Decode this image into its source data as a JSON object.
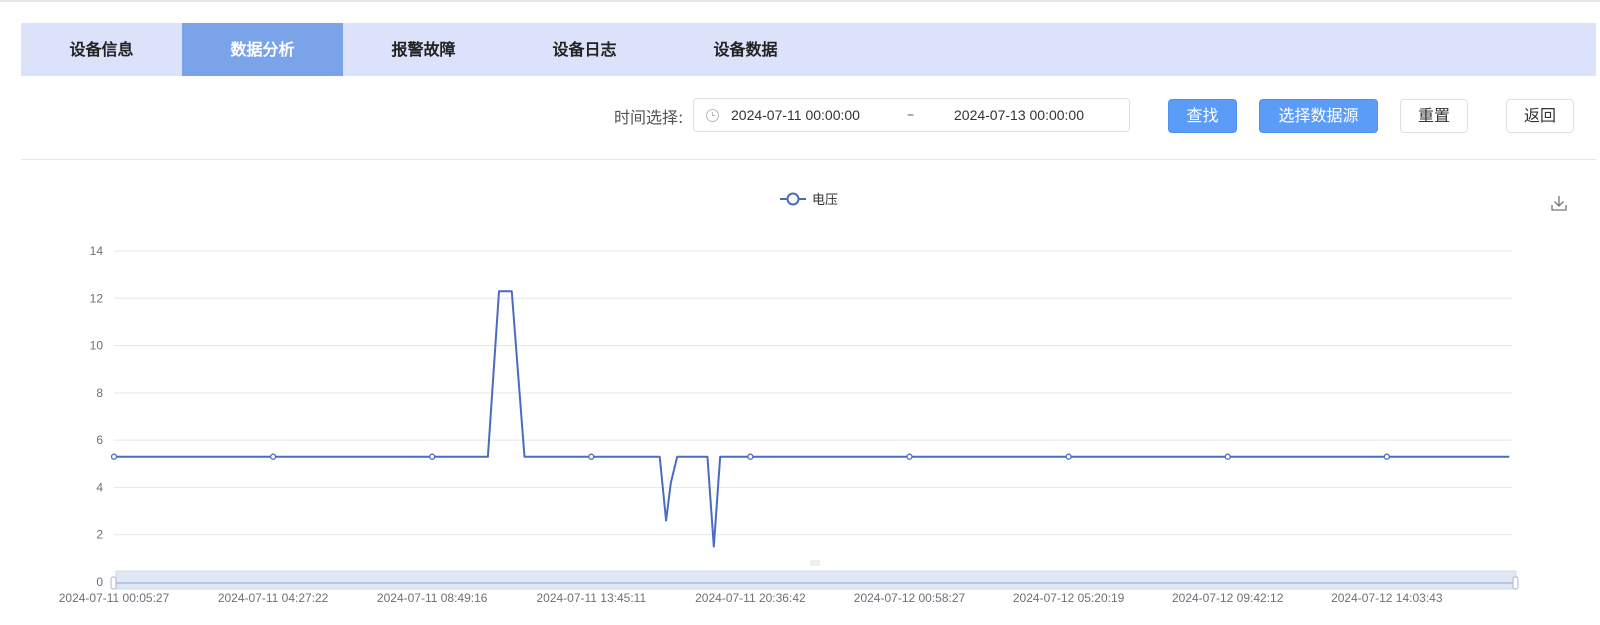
{
  "tabs": [
    {
      "label": "设备信息",
      "active": false
    },
    {
      "label": "数据分析",
      "active": true
    },
    {
      "label": "报警故障",
      "active": false
    },
    {
      "label": "设备日志",
      "active": false
    },
    {
      "label": "设备数据",
      "active": false
    }
  ],
  "toolbar": {
    "time_label": "时间选择:",
    "range_start": "2024-07-11 00:00:00",
    "range_separator": "–",
    "range_end": "2024-07-13 00:00:00",
    "search_label": "查找",
    "select_source_label": "选择数据源",
    "reset_label": "重置",
    "back_label": "返回"
  },
  "colors": {
    "accent": "#5b9cf8",
    "tab_bar": "#dce2fa",
    "tab_active": "#7ba3ea",
    "series": "#4a6bbf"
  },
  "icons": {
    "clock": "clock-icon",
    "download": "download-icon"
  },
  "chart_data": {
    "type": "line",
    "legend": [
      "电压"
    ],
    "legend_position": "top-center",
    "grid": true,
    "ylim": [
      0,
      14
    ],
    "yticks": [
      0,
      2,
      4,
      6,
      8,
      10,
      12,
      14
    ],
    "xticks": [
      "2024-07-11 00:05:27",
      "2024-07-11 04:27:22",
      "2024-07-11 08:49:16",
      "2024-07-11 13:45:11",
      "2024-07-11 20:36:42",
      "2024-07-12 00:58:27",
      "2024-07-12 05:20:19",
      "2024-07-12 09:42:12",
      "2024-07-12 14:03:43"
    ],
    "series": [
      {
        "name": "电压",
        "points": [
          {
            "x": 0,
            "y": 5.3
          },
          {
            "x": 1,
            "y": 5.3
          },
          {
            "x": 2,
            "y": 5.3
          },
          {
            "x": 2.35,
            "y": 5.3
          },
          {
            "x": 2.42,
            "y": 12.3
          },
          {
            "x": 2.5,
            "y": 12.3
          },
          {
            "x": 2.58,
            "y": 5.3
          },
          {
            "x": 3,
            "y": 5.3
          },
          {
            "x": 3.43,
            "y": 5.3
          },
          {
            "x": 3.47,
            "y": 2.6
          },
          {
            "x": 3.5,
            "y": 4.2
          },
          {
            "x": 3.54,
            "y": 5.3
          },
          {
            "x": 3.73,
            "y": 5.3
          },
          {
            "x": 3.77,
            "y": 1.5
          },
          {
            "x": 3.81,
            "y": 5.3
          },
          {
            "x": 4,
            "y": 5.3
          },
          {
            "x": 5,
            "y": 5.3
          },
          {
            "x": 6,
            "y": 5.3
          },
          {
            "x": 7,
            "y": 5.3
          },
          {
            "x": 8,
            "y": 5.3
          },
          {
            "x": 8.77,
            "y": 5.3
          }
        ],
        "markers_at": [
          0,
          1,
          2,
          3,
          4,
          5,
          6,
          7,
          8
        ]
      }
    ]
  }
}
